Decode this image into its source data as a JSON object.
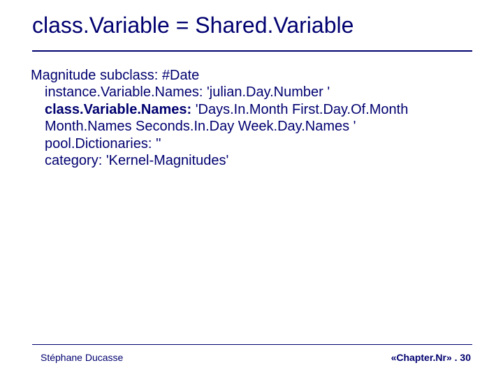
{
  "title": "class.Variable = Shared.Variable",
  "body": {
    "l1": "Magnitude subclass: #Date",
    "l2": "instance.Variable.Names: 'julian.Day.Number '",
    "l3a": "class.Variable.Names:",
    "l3b": " 'Days.In.Month First.Day.Of.Month",
    "l4": "Month.Names Seconds.In.Day Week.Day.Names '",
    "l5": "pool.Dictionaries: ''",
    "l6": "category: 'Kernel-Magnitudes'"
  },
  "footer": {
    "left": "Stéphane Ducasse",
    "right": "«Chapter.Nr» . 30"
  }
}
